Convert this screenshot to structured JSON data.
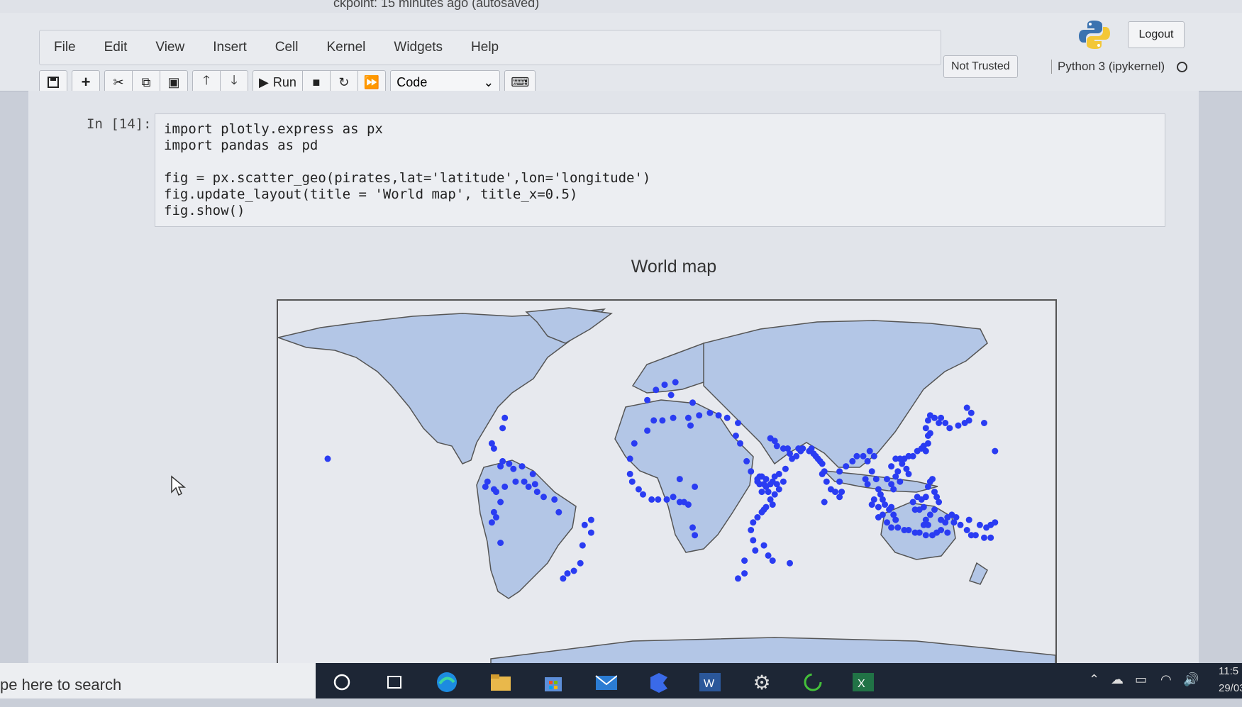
{
  "window": {
    "title_fragment": "ckpoint: 15 minutes ago  (autosaved)"
  },
  "menu": [
    "File",
    "Edit",
    "View",
    "Insert",
    "Cell",
    "Kernel",
    "Widgets",
    "Help"
  ],
  "toolbar": {
    "run_label": "Run",
    "cell_type": "Code"
  },
  "status": {
    "trust": "Not Trusted",
    "kernel": "Python 3 (ipykernel)",
    "logout": "Logout"
  },
  "cell": {
    "prompt": "In [14]:",
    "code": "import plotly.express as px\nimport pandas as pd\n\nfig = px.scatter_geo(pirates,lat='latitude',lon='longitude')\nfig.update_layout(title = 'World map', title_x=0.5)\nfig.show()"
  },
  "output": {
    "title": "World map"
  },
  "taskbar": {
    "search_placeholder": "pe here to search",
    "time": "11:5",
    "date": "29/03/"
  },
  "colors": {
    "land": "#b3c6e6",
    "ocean": "#e7e9ee",
    "marker": "#2a3cf2",
    "coast": "#555555"
  },
  "chart_data": {
    "type": "scatter",
    "title": "World map",
    "projection": "equirectangular",
    "series": [
      {
        "lon_lat": [
          [
            -84,
            10
          ],
          [
            -83,
            12
          ],
          [
            -80,
            9
          ],
          [
            -79,
            8
          ],
          [
            -77,
            18
          ],
          [
            -76,
            20
          ],
          [
            -73,
            19
          ],
          [
            -71,
            17
          ],
          [
            -67,
            18
          ],
          [
            -66,
            12
          ],
          [
            -61,
            11
          ],
          [
            -62,
            15
          ],
          [
            -64,
            10
          ],
          [
            -70,
            12
          ],
          [
            -75,
            10
          ],
          [
            -77,
            4
          ],
          [
            -79,
            -2
          ],
          [
            -80,
            0
          ],
          [
            -81,
            -4
          ],
          [
            -77,
            -12
          ],
          [
            -38,
            -5
          ],
          [
            -35,
            -8
          ],
          [
            -39,
            -13
          ],
          [
            -40,
            -20
          ],
          [
            -43,
            -23
          ],
          [
            -46,
            -24
          ],
          [
            -48,
            -26
          ],
          [
            -52,
            5
          ],
          [
            -57,
            6
          ],
          [
            -60,
            8
          ],
          [
            -50,
            0
          ],
          [
            -35,
            -3
          ],
          [
            -80,
            25
          ],
          [
            -81,
            27
          ],
          [
            -76,
            33
          ],
          [
            -75,
            37
          ],
          [
            -157,
            21
          ],
          [
            -17,
            15
          ],
          [
            -16,
            12
          ],
          [
            -13,
            9
          ],
          [
            -11,
            7
          ],
          [
            -7,
            5
          ],
          [
            -4,
            5
          ],
          [
            0,
            5
          ],
          [
            3,
            6
          ],
          [
            6,
            4
          ],
          [
            8,
            4
          ],
          [
            10,
            3
          ],
          [
            12,
            -6
          ],
          [
            13,
            -9
          ],
          [
            -17,
            21
          ],
          [
            -15,
            27
          ],
          [
            -9,
            32
          ],
          [
            -6,
            36
          ],
          [
            -2,
            36
          ],
          [
            3,
            37
          ],
          [
            10,
            37
          ],
          [
            11,
            34
          ],
          [
            15,
            38
          ],
          [
            20,
            39
          ],
          [
            24,
            38
          ],
          [
            28,
            37
          ],
          [
            33,
            35
          ],
          [
            -9,
            44
          ],
          [
            -5,
            48
          ],
          [
            4,
            51
          ],
          [
            -1,
            50
          ],
          [
            2,
            46
          ],
          [
            12,
            43
          ],
          [
            32,
            30
          ],
          [
            34,
            27
          ],
          [
            37,
            20
          ],
          [
            39,
            16
          ],
          [
            42,
            13
          ],
          [
            43,
            11
          ],
          [
            45,
            11
          ],
          [
            48,
            11
          ],
          [
            51,
            11
          ],
          [
            50,
            7
          ],
          [
            48,
            5
          ],
          [
            46,
            2
          ],
          [
            44,
            0
          ],
          [
            42,
            -2
          ],
          [
            40,
            -4
          ],
          [
            39,
            -7
          ],
          [
            40,
            -11
          ],
          [
            41,
            -15
          ],
          [
            36,
            -19
          ],
          [
            36,
            -24
          ],
          [
            33,
            -26
          ],
          [
            45,
            -13
          ],
          [
            47,
            -17
          ],
          [
            49,
            -19
          ],
          [
            57,
            -20
          ],
          [
            44,
            14
          ],
          [
            46,
            13
          ],
          [
            50,
            14
          ],
          [
            52,
            15
          ],
          [
            55,
            17
          ],
          [
            58,
            21
          ],
          [
            57,
            23
          ],
          [
            56,
            25
          ],
          [
            54,
            25
          ],
          [
            51,
            26
          ],
          [
            50,
            28
          ],
          [
            48,
            29
          ],
          [
            49,
            12
          ],
          [
            46,
            10
          ],
          [
            43,
            14
          ],
          [
            42,
            12
          ],
          [
            44,
            8
          ],
          [
            47,
            8
          ],
          [
            52,
            9
          ],
          [
            54,
            12
          ],
          [
            60,
            22
          ],
          [
            62,
            24
          ],
          [
            66,
            24
          ],
          [
            68,
            23
          ],
          [
            70,
            21
          ],
          [
            72,
            19
          ],
          [
            73,
            16
          ],
          [
            74,
            12
          ],
          [
            76,
            9
          ],
          [
            78,
            8
          ],
          [
            80,
            12
          ],
          [
            80,
            16
          ],
          [
            83,
            18
          ],
          [
            86,
            20
          ],
          [
            88,
            22
          ],
          [
            91,
            22
          ],
          [
            93,
            20
          ],
          [
            95,
            16
          ],
          [
            97,
            13
          ],
          [
            98,
            9
          ],
          [
            99,
            7
          ],
          [
            100,
            5
          ],
          [
            101,
            3
          ],
          [
            103,
            1
          ],
          [
            104,
            2
          ],
          [
            105,
            -1
          ],
          [
            106,
            -3
          ],
          [
            107,
            -6
          ],
          [
            110,
            -7
          ],
          [
            112,
            -7
          ],
          [
            115,
            -8
          ],
          [
            117,
            -8
          ],
          [
            120,
            -9
          ],
          [
            123,
            -9
          ],
          [
            125,
            -8
          ],
          [
            127,
            -7
          ],
          [
            130,
            -8
          ],
          [
            133,
            -4
          ],
          [
            136,
            -5
          ],
          [
            139,
            -7
          ],
          [
            141,
            -9
          ],
          [
            143,
            -9
          ],
          [
            147,
            -10
          ],
          [
            150,
            -10
          ],
          [
            102,
            13
          ],
          [
            104,
            11
          ],
          [
            105,
            9
          ],
          [
            106,
            14
          ],
          [
            107,
            16
          ],
          [
            108,
            12
          ],
          [
            109,
            19
          ],
          [
            110,
            21
          ],
          [
            112,
            22
          ],
          [
            114,
            22
          ],
          [
            116,
            24
          ],
          [
            118,
            25
          ],
          [
            119,
            26
          ],
          [
            120,
            24
          ],
          [
            121,
            27
          ],
          [
            121,
            30
          ],
          [
            122,
            31
          ],
          [
            120,
            33
          ],
          [
            121,
            36
          ],
          [
            122,
            38
          ],
          [
            124,
            37
          ],
          [
            126,
            35
          ],
          [
            127,
            37
          ],
          [
            129,
            35
          ],
          [
            131,
            33
          ],
          [
            135,
            34
          ],
          [
            138,
            35
          ],
          [
            140,
            36
          ],
          [
            141,
            39
          ],
          [
            139,
            41
          ],
          [
            147,
            35
          ],
          [
            152,
            24
          ],
          [
            114,
            4
          ],
          [
            116,
            6
          ],
          [
            118,
            5
          ],
          [
            119,
            2
          ],
          [
            117,
            1
          ],
          [
            115,
            1
          ],
          [
            120,
            6
          ],
          [
            121,
            10
          ],
          [
            122,
            12
          ],
          [
            123,
            13
          ],
          [
            124,
            8
          ],
          [
            125,
            6
          ],
          [
            126,
            4
          ],
          [
            124,
            1
          ],
          [
            122,
            -1
          ],
          [
            120,
            -3
          ],
          [
            119,
            -5
          ],
          [
            121,
            -5
          ],
          [
            127,
            -3
          ],
          [
            129,
            -4
          ],
          [
            130,
            -2
          ],
          [
            132,
            -1
          ],
          [
            134,
            -2
          ],
          [
            100,
            -1
          ],
          [
            98,
            2
          ],
          [
            96,
            5
          ],
          [
            95,
            3
          ],
          [
            98,
            -2
          ],
          [
            102,
            -4
          ],
          [
            104,
            -6
          ],
          [
            92,
            13
          ],
          [
            93,
            11
          ],
          [
            80,
            6
          ],
          [
            81,
            8
          ],
          [
            73,
            4
          ],
          [
            72,
            15
          ],
          [
            71,
            20
          ],
          [
            69,
            22
          ],
          [
            67,
            25
          ],
          [
            63,
            25
          ],
          [
            61,
            25
          ],
          [
            49,
            3
          ],
          [
            45,
            1
          ],
          [
            13,
            10
          ],
          [
            6,
            13
          ],
          [
            140,
            -3
          ],
          [
            145,
            -5
          ],
          [
            148,
            -6
          ],
          [
            150,
            -5
          ],
          [
            152,
            -4
          ],
          [
            104,
            18
          ],
          [
            106,
            21
          ],
          [
            108,
            21
          ],
          [
            111,
            17
          ],
          [
            112,
            15
          ],
          [
            96,
            22
          ],
          [
            94,
            24
          ]
        ]
      }
    ]
  }
}
